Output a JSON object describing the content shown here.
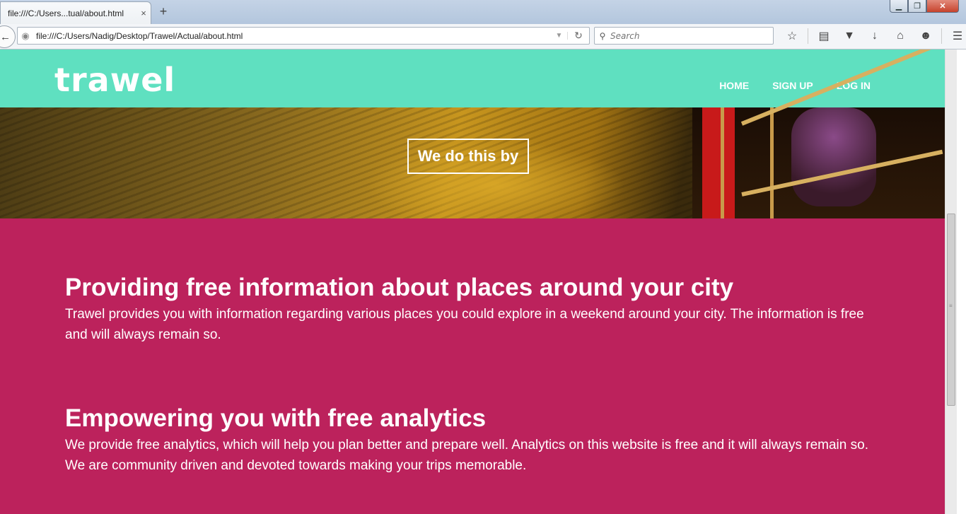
{
  "browser": {
    "tab_title": "file:///C:/Users...tual/about.html",
    "tab_close": "×",
    "new_tab": "+",
    "window_controls": {
      "minimize": "▁",
      "maximize": "❐",
      "close": "✕"
    },
    "url": "file:///C:/Users/Nadig/Desktop/Trawel/Actual/about.html",
    "search_placeholder": "Search",
    "toolbar_icons": [
      "star-icon",
      "reading-list-icon",
      "pocket-icon",
      "download-icon",
      "home-icon",
      "chat-icon",
      "menu-icon"
    ]
  },
  "site": {
    "logo": "trawel",
    "nav": [
      {
        "label": "HOME"
      },
      {
        "label": "SIGN UP"
      },
      {
        "label": "LOG IN"
      }
    ],
    "hero_text": "We do this by",
    "sections": [
      {
        "heading": "Providing free information about places around your city",
        "body": "Trawel provides you with information regarding various places you could explore in a weekend around your city. The information is free and will always remain so."
      },
      {
        "heading": "Empowering you with free analytics",
        "body": "We provide free analytics, which will help you plan better and prepare well. Analytics on this website is free and it will always remain so. We are community driven and devoted towards making your trips memorable."
      }
    ]
  },
  "colors": {
    "header": "#5fe0c0",
    "content_bg": "#bc225c",
    "text": "#ffffff"
  }
}
